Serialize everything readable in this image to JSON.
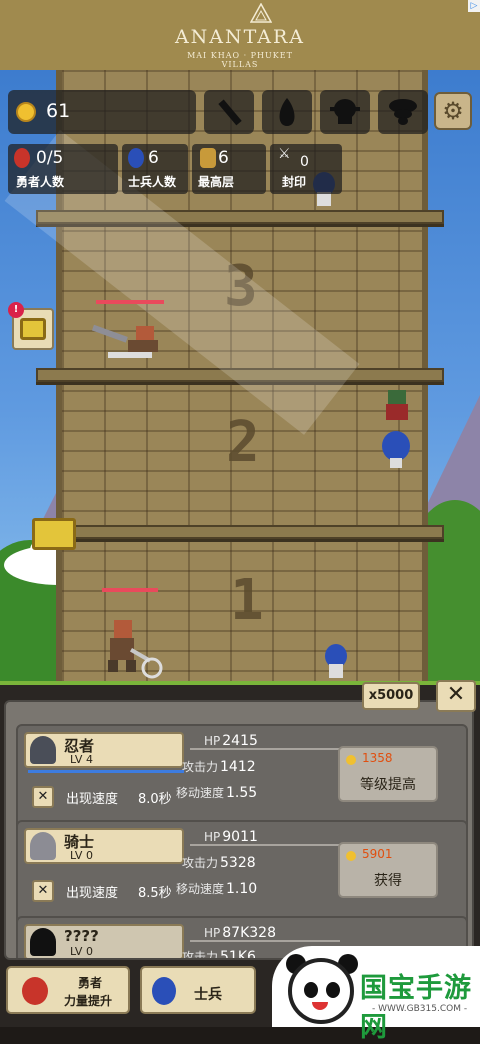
{
  "ad": {
    "brand": "ANANTARA",
    "line1": "MAI KHAO · PHUKET",
    "line2": "VILLAS",
    "badge": "▷"
  },
  "hud": {
    "coins": "61",
    "tools": [
      "club-icon",
      "seed-icon",
      "skull-icon",
      "tornado-icon"
    ],
    "settings_icon": "gear-icon",
    "stats": [
      {
        "value": "0/5",
        "label": "勇者人数",
        "icon": "hero-icon"
      },
      {
        "value": "6",
        "label": "士兵人数",
        "icon": "soldier-icon"
      },
      {
        "value": "6",
        "label": "最高层",
        "icon": "floor-icon"
      },
      {
        "value": "0",
        "label": "封印",
        "icon": "seal-icon"
      }
    ]
  },
  "tower": {
    "floors": [
      "3",
      "2",
      "1"
    ],
    "notice": "!"
  },
  "panel": {
    "multiplier": "x5000",
    "close": "✕",
    "units": [
      {
        "name": "忍者",
        "level": "LV 4",
        "hp_label": "HP",
        "hp": "2415",
        "atk_label": "攻击力",
        "atk": "1412",
        "spd_label": "移动速度",
        "spd": "1.55",
        "spawn_label": "出现速度",
        "spawn": "8.0秒",
        "cost": "1358",
        "action": "等级提高"
      },
      {
        "name": "骑士",
        "level": "LV 0",
        "hp_label": "HP",
        "hp": "9011",
        "atk_label": "攻击力",
        "atk": "5328",
        "spd_label": "移动速度",
        "spd": "1.10",
        "spawn_label": "出现速度",
        "spawn": "8.5秒",
        "cost": "5901",
        "action": "获得"
      },
      {
        "name": "????",
        "level": "LV 0",
        "hp_label": "HP",
        "hp": "87K328",
        "atk_label": "攻击力",
        "atk": "51K6"
      }
    ]
  },
  "tabs": [
    {
      "line1": "勇者",
      "line2": "力量提升"
    },
    {
      "line1": "士兵",
      "line2": ""
    }
  ],
  "watermark": {
    "title": "国宝手游网",
    "url": "- WWW.GB315.COM -"
  },
  "colors": {
    "sky": "#5f9ae0",
    "brick": "#9a8658",
    "panel": "#7a7670",
    "card_label": "#eadcb6",
    "cost": "#e04f10"
  }
}
